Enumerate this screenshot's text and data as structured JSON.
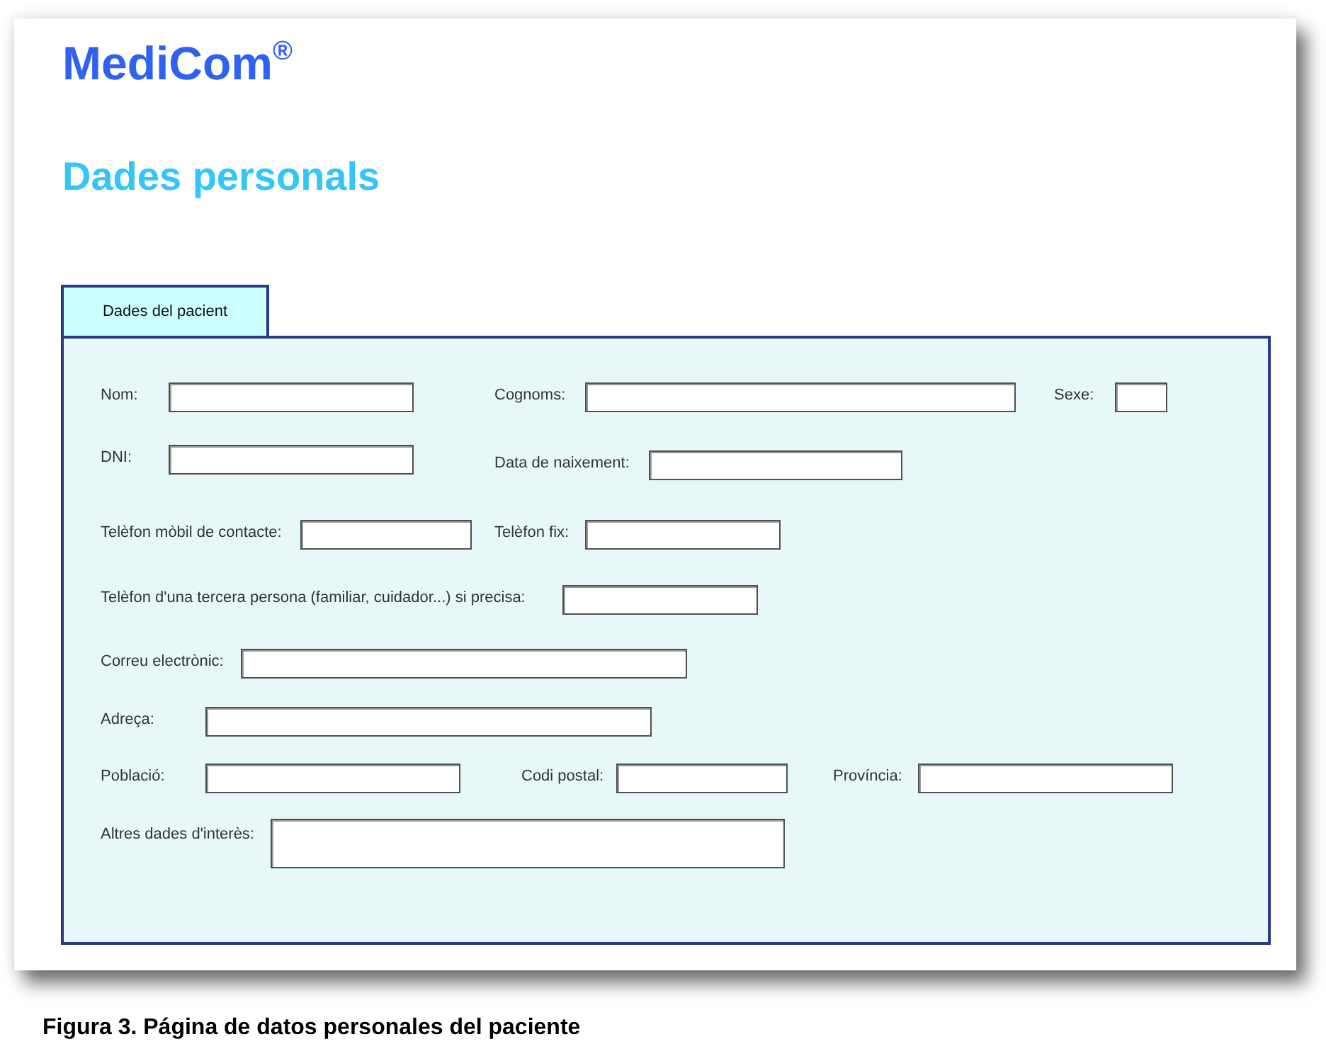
{
  "header": {
    "logo": "MediCom$^{®}$",
    "title": "Dades personals"
  },
  "tabs": [
    {
      "label": "Dades del pacient",
      "selected": true
    }
  ],
  "form": {
    "rows": [
      [
        {
          "label": "Nom:",
          "kind": "text"
        },
        {
          "label": "Cognoms:",
          "kind": "text"
        },
        {
          "label": "Sexe:",
          "kind": "text"
        }
      ],
      [
        {
          "label": "DNI:",
          "kind": "text"
        },
        {
          "label": "Data de naixement:",
          "kind": "text"
        }
      ],
      [
        {
          "label": "Telèfon mòbil de contacte:",
          "kind": "text"
        },
        {
          "label": "Telèfon fix:",
          "kind": "text"
        }
      ],
      [
        {
          "label": "Telèfon d'una tercera persona (familiar, cuidador...) si precisa:",
          "kind": "text"
        }
      ],
      [
        {
          "label": "Correu electrònic:",
          "kind": "text"
        }
      ],
      [
        {
          "label": "Adreça:",
          "kind": "text"
        }
      ],
      [
        {
          "label": "Població:",
          "kind": "text"
        },
        {
          "label": "Codi postal:",
          "kind": "text"
        },
        {
          "label": "Província:",
          "kind": "text"
        }
      ],
      [
        {
          "label": "Altres dades d'interès:",
          "kind": "multiline"
        }
      ]
    ]
  },
  "caption": "Figura 3. Página de datos personales del paciente"
}
